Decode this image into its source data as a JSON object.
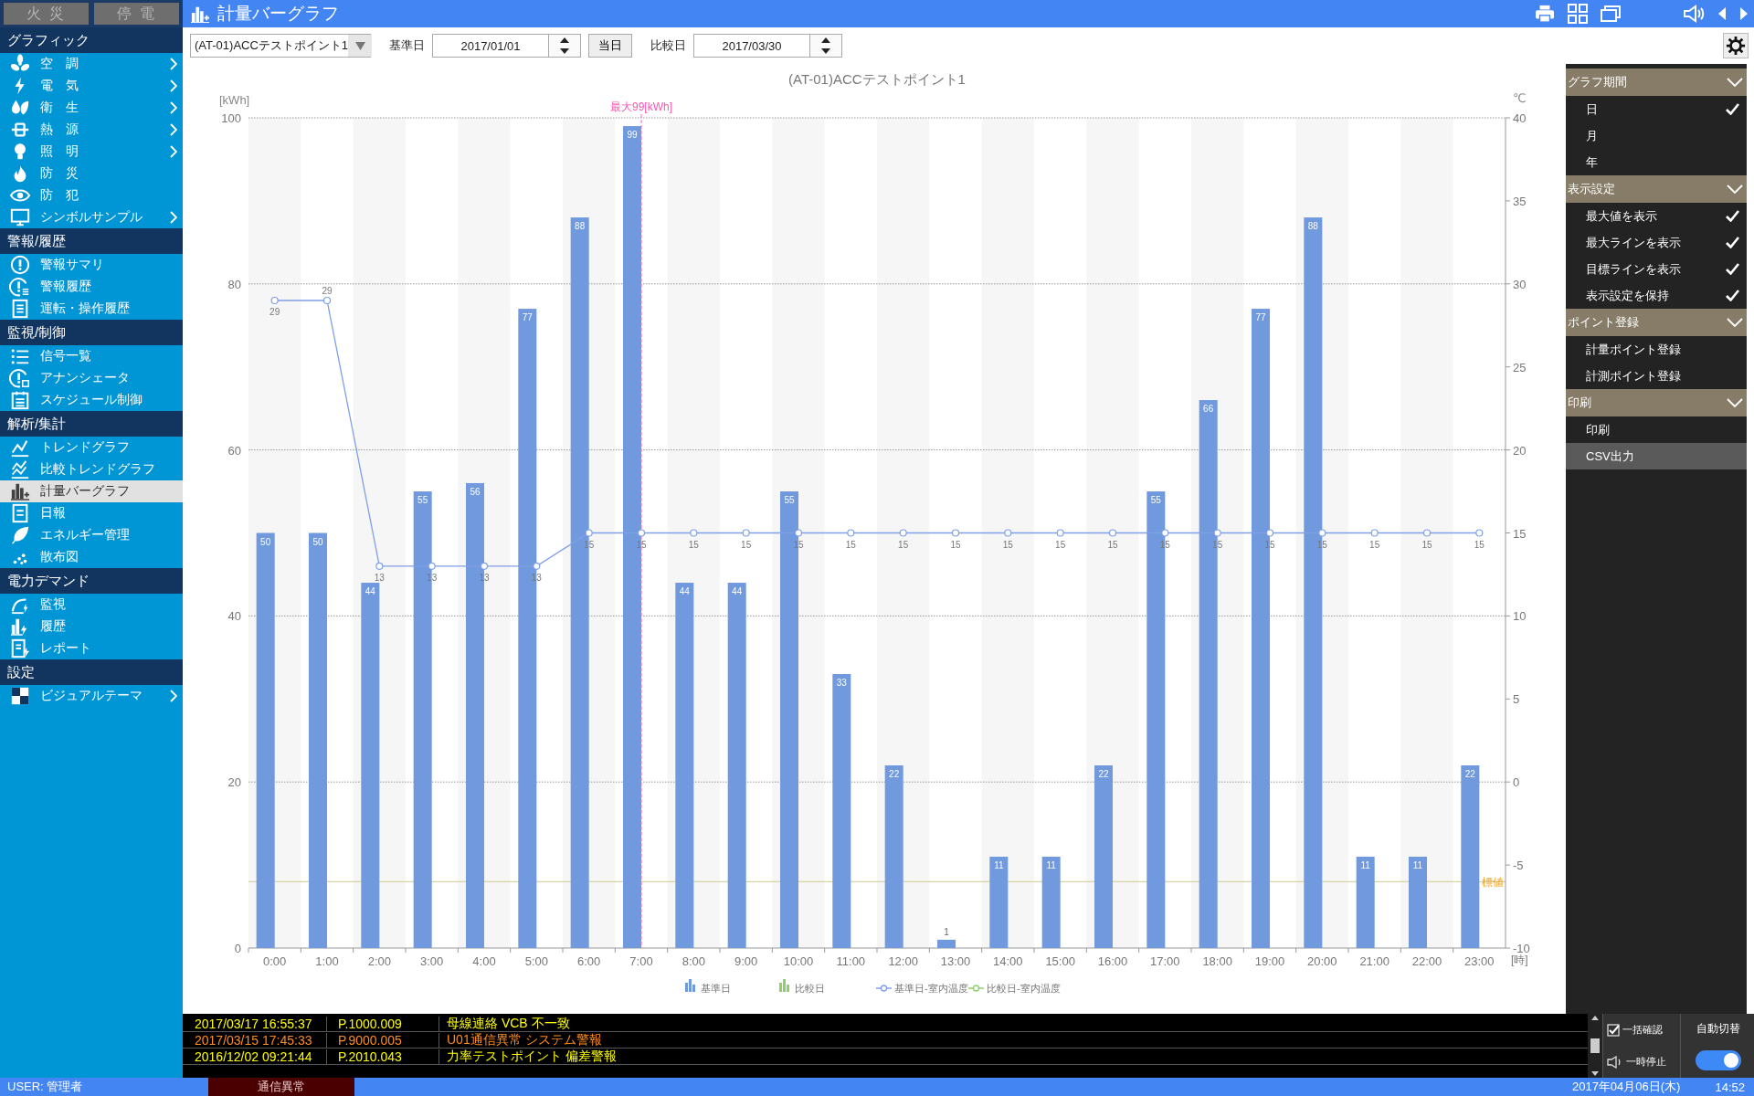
{
  "header": {
    "alarm_buttons": [
      {
        "label": "火 災",
        "active": false
      },
      {
        "label": "停 電",
        "active": false
      }
    ],
    "title": "計量バーグラフ"
  },
  "sidebar": {
    "sections": [
      {
        "title": "グラフィック",
        "items": [
          {
            "label": "空　調",
            "submenu": true,
            "selected": false
          },
          {
            "label": "電　気",
            "submenu": true,
            "selected": false
          },
          {
            "label": "衛　生",
            "submenu": true,
            "selected": false
          },
          {
            "label": "熱　源",
            "submenu": true,
            "selected": false
          },
          {
            "label": "照　明",
            "submenu": true,
            "selected": false
          },
          {
            "label": "防　災",
            "submenu": false,
            "selected": false
          },
          {
            "label": "防　犯",
            "submenu": false,
            "selected": false
          },
          {
            "label": "シンボルサンプル",
            "submenu": true,
            "selected": false
          }
        ]
      },
      {
        "title": "警報/履歴",
        "items": [
          {
            "label": "警報サマリ",
            "submenu": false,
            "selected": false
          },
          {
            "label": "警報履歴",
            "submenu": false,
            "selected": false
          },
          {
            "label": "運転・操作履歴",
            "submenu": false,
            "selected": false
          }
        ]
      },
      {
        "title": "監視/制御",
        "items": [
          {
            "label": "信号一覧",
            "submenu": false,
            "selected": false
          },
          {
            "label": "アナンシェータ",
            "submenu": false,
            "selected": false
          },
          {
            "label": "スケジュール制御",
            "submenu": false,
            "selected": false
          }
        ]
      },
      {
        "title": "解析/集計",
        "items": [
          {
            "label": "トレンドグラフ",
            "submenu": false,
            "selected": false
          },
          {
            "label": "比較トレンドグラフ",
            "submenu": false,
            "selected": false
          },
          {
            "label": "計量バーグラフ",
            "submenu": false,
            "selected": true
          },
          {
            "label": "日報",
            "submenu": false,
            "selected": false
          },
          {
            "label": "エネルギー管理",
            "submenu": false,
            "selected": false
          },
          {
            "label": "散布図",
            "submenu": false,
            "selected": false
          }
        ]
      },
      {
        "title": "電力デマンド",
        "items": [
          {
            "label": "監視",
            "submenu": false,
            "selected": false
          },
          {
            "label": "履歴",
            "submenu": false,
            "selected": false
          },
          {
            "label": "レポート",
            "submenu": false,
            "selected": false
          }
        ]
      },
      {
        "title": "設定",
        "items": [
          {
            "label": "ビジュアルテーマ",
            "submenu": true,
            "selected": false
          }
        ]
      }
    ]
  },
  "toolbar": {
    "point": "(AT-01)ACCテストポイント1",
    "base_label": "基準日",
    "base_date": "2017/01/01",
    "today_button": "当日",
    "compare_label": "比較日",
    "compare_date": "2017/03/30"
  },
  "chart": {
    "chart_data": {
      "type": "bar",
      "title": "(AT-01)ACCテストポイント1",
      "xlabel": "[時]",
      "ylabel": "[kWh]",
      "categories": [
        "0:00",
        "1:00",
        "2:00",
        "3:00",
        "4:00",
        "5:00",
        "6:00",
        "7:00",
        "8:00",
        "9:00",
        "10:00",
        "11:00",
        "12:00",
        "13:00",
        "14:00",
        "15:00",
        "16:00",
        "17:00",
        "18:00",
        "19:00",
        "20:00",
        "21:00",
        "22:00",
        "23:00"
      ],
      "series": [
        {
          "name": "基準日",
          "color": "#7099de",
          "values": [
            50,
            50,
            44,
            55,
            56,
            77,
            88,
            99,
            44,
            44,
            55,
            33,
            22,
            1,
            11,
            11,
            22,
            55,
            66,
            77,
            88,
            11,
            11,
            22
          ]
        },
        {
          "name": "比較日",
          "color": "#8fcf6a",
          "values": [
            null,
            null,
            null,
            null,
            null,
            null,
            null,
            null,
            null,
            null,
            null,
            null,
            null,
            null,
            null,
            null,
            null,
            null,
            null,
            null,
            null,
            null,
            null,
            null
          ]
        }
      ],
      "ylim": [
        0,
        100
      ],
      "yticks": [
        0,
        20,
        40,
        60,
        80,
        100
      ],
      "data_labels": true,
      "grid": true,
      "ref_lines": [
        {
          "axis": "x",
          "value": "7:00",
          "label": "最大99[kWh]"
        },
        {
          "axis": "y",
          "value": 8,
          "label": "標値"
        }
      ]
    }
  },
  "temperature_overlay": {
    "chart_data": {
      "type": "line",
      "ylabel": "℃",
      "series": [
        {
          "name": "基準日-室内温度",
          "color": "#7f9fe6",
          "marker": "o",
          "values": [
            29,
            29,
            13,
            13,
            13,
            13,
            15,
            15,
            15,
            15,
            15,
            15,
            15,
            15,
            15,
            15,
            15,
            15,
            15,
            15,
            15,
            15,
            15,
            15
          ]
        },
        {
          "name": "比較日-室内温度",
          "color": "#8fcf6a",
          "values": [
            null,
            null,
            null,
            null,
            null,
            null,
            null,
            null,
            null,
            null,
            null,
            null,
            null,
            null,
            null,
            null,
            null,
            null,
            null,
            null,
            null,
            null,
            null,
            null
          ]
        }
      ],
      "ylim": [
        -10,
        40
      ],
      "yticks": [
        -10,
        -5,
        0,
        5,
        10,
        15,
        20,
        25,
        30,
        35,
        40
      ],
      "data_labels": true
    }
  },
  "settings_panel": {
    "sections": [
      {
        "title": "グラフ期間",
        "expanded": true,
        "items": [
          {
            "label": "日",
            "checked": true,
            "selected": false
          },
          {
            "label": "月",
            "checked": false,
            "selected": false
          },
          {
            "label": "年",
            "checked": false,
            "selected": false
          }
        ]
      },
      {
        "title": "表示設定",
        "expanded": true,
        "items": [
          {
            "label": "最大値を表示",
            "checked": true,
            "selected": false
          },
          {
            "label": "最大ラインを表示",
            "checked": true,
            "selected": false
          },
          {
            "label": "目標ラインを表示",
            "checked": true,
            "selected": false
          },
          {
            "label": "表示設定を保持",
            "checked": true,
            "selected": false
          }
        ]
      },
      {
        "title": "ポイント登録",
        "expanded": true,
        "items": [
          {
            "label": "計量ポイント登録",
            "checked": false,
            "selected": false
          },
          {
            "label": "計測ポイント登録",
            "checked": false,
            "selected": false
          }
        ]
      },
      {
        "title": "印刷",
        "expanded": true,
        "items": [
          {
            "label": "印刷",
            "checked": false,
            "selected": false
          },
          {
            "label": "CSV出力",
            "checked": false,
            "selected": true
          }
        ]
      }
    ]
  },
  "alarms": [
    {
      "time": "2017/03/17 16:55:37",
      "point": "P.1000.009",
      "message": "母線連絡 VCB 不一致",
      "color": "#ffff00"
    },
    {
      "time": "2017/03/15 17:45:33",
      "point": "P.9000.005",
      "message": "U01通信異常 システム警報",
      "color": "#ff8c1a"
    },
    {
      "time": "2016/12/02 09:21:44",
      "point": "P.2010.043",
      "message": "力率テストポイント 偏差警報",
      "color": "#ffff00"
    }
  ],
  "alarm_controls": {
    "confirm_all": {
      "label": "一括確認",
      "checked": true
    },
    "pause": "一時停止",
    "auto_switch": {
      "label": "自動切替",
      "on": true
    }
  },
  "status_bar": {
    "user": "USER: 管理者",
    "comm_status": "通信異常",
    "date": "2017年04月06日(木)",
    "time": "14:52"
  }
}
